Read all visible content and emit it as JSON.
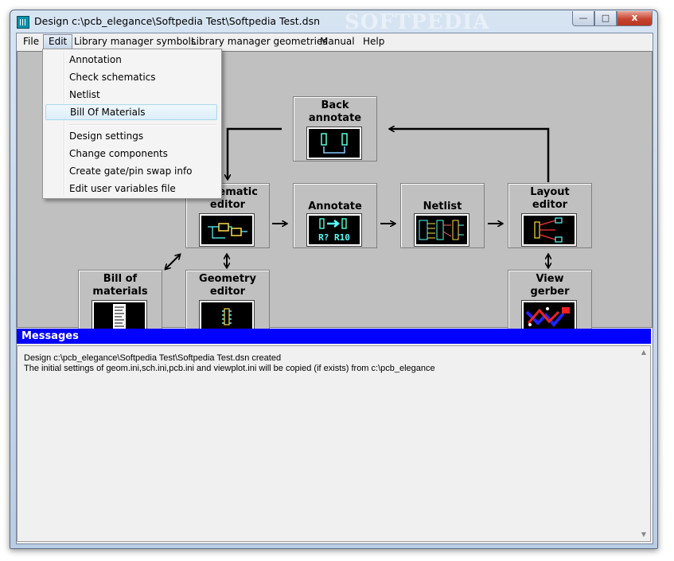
{
  "window": {
    "title": "Design c:\\pcb_elegance\\Softpedia Test\\Softpedia Test.dsn",
    "watermark": "SOFTPEDIA",
    "controls": {
      "minimize": "—",
      "maximize": "□",
      "close": "x"
    }
  },
  "menubar": {
    "items": [
      {
        "label": "File"
      },
      {
        "label": "Edit"
      },
      {
        "label": "Library manager symbols"
      },
      {
        "label": "Library manager geometries"
      },
      {
        "label": "Manual"
      },
      {
        "label": "Help"
      }
    ],
    "open_menu": "Edit"
  },
  "edit_menu": {
    "items": [
      {
        "label": "Annotation"
      },
      {
        "label": "Check schematics"
      },
      {
        "label": "Netlist"
      },
      {
        "label": "Bill Of Materials",
        "highlighted": true
      },
      {
        "label": "Design settings"
      },
      {
        "label": "Change components"
      },
      {
        "label": "Create gate/pin swap info"
      },
      {
        "label": "Edit user variables file"
      }
    ]
  },
  "flow": {
    "back_annotate": {
      "line1": "Back",
      "line2": "annotate"
    },
    "schematic_editor": {
      "line1": "Schematic",
      "line2": "editor"
    },
    "annotate": {
      "line1": "Annotate",
      "icon_text": "R? R10"
    },
    "netlist": {
      "line1": "Netlist"
    },
    "layout_editor": {
      "line1": "Layout",
      "line2": "editor"
    },
    "bill_of_materials": {
      "line1": "Bill of",
      "line2": "materials"
    },
    "geometry_editor": {
      "line1": "Geometry",
      "line2": "editor"
    },
    "view_gerber": {
      "line1": "View",
      "line2": "gerber"
    }
  },
  "messages": {
    "title": "Messages",
    "lines": [
      "Design c:\\pcb_elegance\\Softpedia Test\\Softpedia Test.dsn created",
      "The initial settings of geom.ini,sch.ini,pcb.ini and viewplot.ini will be copied (if exists) from c:\\pcb_elegance"
    ]
  },
  "colors": {
    "messages_bar": "#0000ff",
    "canvas": "#c0c0c0",
    "menu_highlight": "#dbeef9"
  }
}
